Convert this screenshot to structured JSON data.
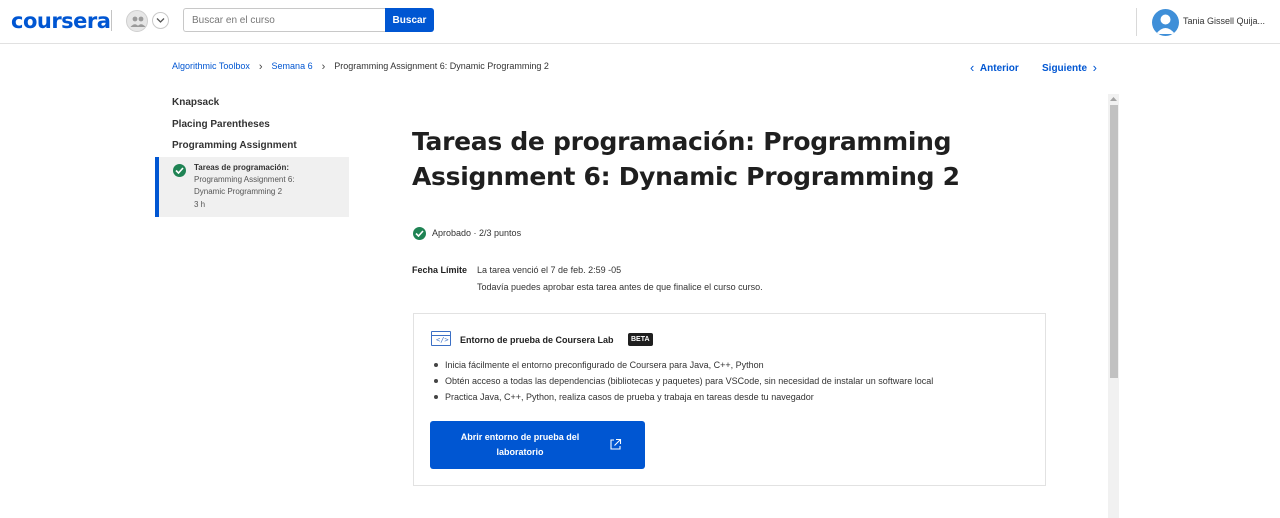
{
  "header": {
    "logo": "coursera",
    "search_placeholder": "Buscar en el curso",
    "search_button": "Buscar",
    "user_name": "Tania Gissell Quija..."
  },
  "breadcrumb": {
    "items": [
      "Algorithmic Toolbox",
      "Semana 6",
      "Programming Assignment 6: Dynamic Programming 2"
    ]
  },
  "nav": {
    "prev": "Anterior",
    "next": "Siguiente"
  },
  "sidebar": {
    "items": [
      "Knapsack",
      "Placing Parentheses",
      "Programming Assignment"
    ],
    "active": {
      "title": "Tareas de programación:",
      "lines": [
        "Programming Assignment 6:",
        "Dynamic Programming 2"
      ],
      "duration": "3 h"
    }
  },
  "main": {
    "title": "Tareas de programación: Programming Assignment 6: Dynamic Programming 2",
    "status": "Aprobado · 2/3 puntos",
    "deadline_label": "Fecha Límite",
    "deadline_text": "La tarea venció el 7 de feb. 2:59 -05",
    "deadline_note": "Todavía puedes aprobar esta tarea antes de que finalice el curso curso."
  },
  "lab": {
    "icon": "code-window-icon",
    "title": "Entorno de prueba de Coursera Lab",
    "badge": "BETA",
    "bullets": [
      "Inicia fácilmente el entorno preconfigurado de Coursera para Java, C++, Python",
      "Obtén acceso a todas las dependencias (bibliotecas y paquetes) para VSCode, sin necesidad de instalar un software local",
      "Practica Java, C++, Python, realiza casos de prueba y trabaja en tareas desde tu navegador"
    ],
    "button": "Abrir entorno de prueba del laboratorio"
  },
  "colors": {
    "brand": "#0056d2",
    "success": "#1f8354",
    "active_bg": "#f0f0f0"
  }
}
